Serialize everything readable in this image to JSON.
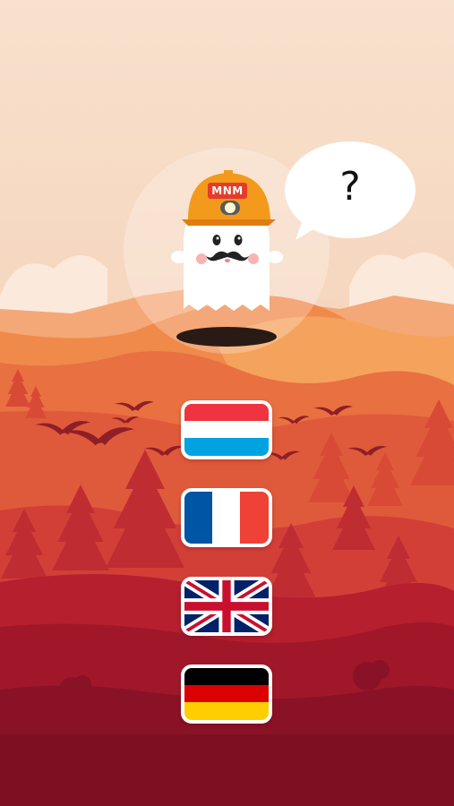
{
  "mascot": {
    "helmet_text": "MNM",
    "speech_text": "?"
  },
  "language_options": [
    {
      "flag": "flag-luxembourg",
      "colors": [
        "#ef3340",
        "#ffffff",
        "#00a3e0"
      ]
    },
    {
      "flag": "flag-france",
      "colors": [
        "#0055a4",
        "#ffffff",
        "#ef4135"
      ]
    },
    {
      "flag": "flag-united-kingdom",
      "colors": [
        "#012169",
        "#ffffff",
        "#c8102e"
      ]
    },
    {
      "flag": "flag-germany",
      "colors": [
        "#000000",
        "#dd0000",
        "#ffce00"
      ]
    }
  ],
  "theme": {
    "sky": "#f7dcc6",
    "mountain": "#f08a4b",
    "forest": "#d84a3c",
    "ground": "#7e0f22"
  }
}
